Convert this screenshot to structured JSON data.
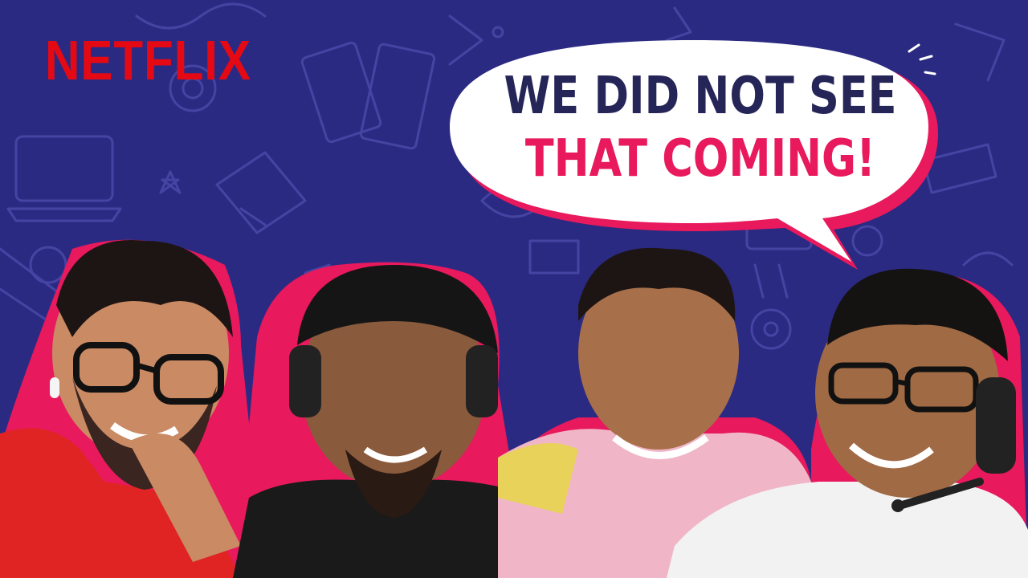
{
  "brand": {
    "logo_text": "NETFLIX",
    "logo_color": "#e50914"
  },
  "speech_bubble": {
    "line1": "WE DID NOT SEE",
    "line2": "THAT COMING!",
    "line1_color": "#262558",
    "line2_color": "#e8195c",
    "outline_color": "#e8195c"
  },
  "background": {
    "color": "#2b2a82",
    "pattern": "doodle-icons"
  },
  "people": [
    {
      "shirt": "red",
      "accessory": "earbud"
    },
    {
      "shirt": "black",
      "accessory": "headset-and-cap"
    },
    {
      "shirt": "pink-yellow",
      "accessory": "none"
    },
    {
      "shirt": "white",
      "accessory": "headset-with-mic"
    }
  ]
}
